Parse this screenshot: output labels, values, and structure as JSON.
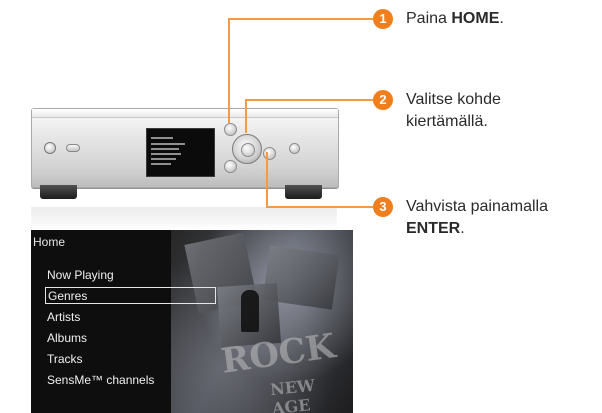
{
  "menu": {
    "title": "Home",
    "items": [
      {
        "label": "Now Playing",
        "selected": false
      },
      {
        "label": "Genres",
        "selected": true
      },
      {
        "label": "Artists",
        "selected": false
      },
      {
        "label": "Albums",
        "selected": false
      },
      {
        "label": "Tracks",
        "selected": false
      },
      {
        "label": "SensMe™ channels",
        "selected": false
      }
    ]
  },
  "background_art_words": [
    "ROCK",
    "NEW AGE"
  ],
  "steps": [
    {
      "number": "1",
      "text_before": "Paina ",
      "bold": "HOME",
      "text_after": "."
    },
    {
      "number": "2",
      "line1": "Valitse kohde",
      "line2": "kiertämällä."
    },
    {
      "number": "3",
      "line1": "Vahvista painamalla",
      "bold": "ENTER",
      "text_after": "."
    }
  ],
  "colors": {
    "accent": "#f07e1d",
    "callout_line": "#f39a44",
    "screen_bg": "#0e0e0e",
    "text": "#2a2a2a"
  }
}
